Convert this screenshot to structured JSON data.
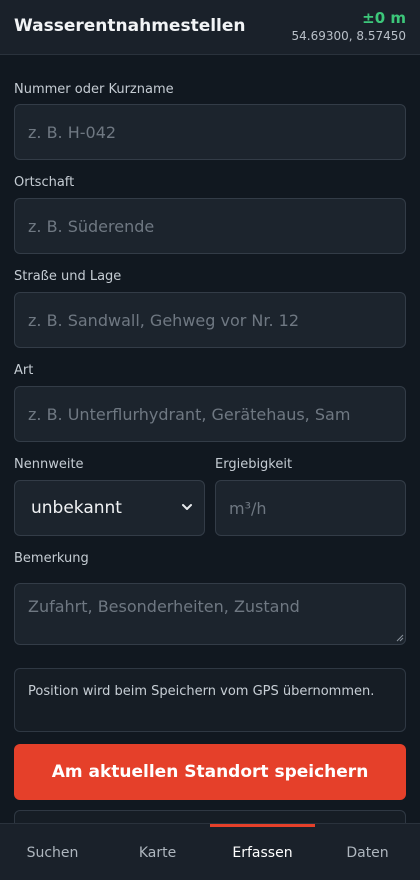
{
  "header": {
    "title": "Wasserentnahmestellen",
    "gps_accuracy": "±0 m",
    "gps_coords": "54.69300, 8.57450",
    "accuracy_color": "#3cc77a"
  },
  "form": {
    "nummer": {
      "label": "Nummer oder Kurzname",
      "placeholder": "z. B. H-042",
      "value": ""
    },
    "ortschaft": {
      "label": "Ortschaft",
      "placeholder": "z. B. Süderende",
      "value": ""
    },
    "strasse": {
      "label": "Straße und Lage",
      "placeholder": "z. B. Sandwall, Gehweg vor Nr. 12",
      "value": ""
    },
    "art": {
      "label": "Art",
      "placeholder": "z. B. Unterflurhydrant, Gerätehaus, Sam",
      "value": ""
    },
    "nennweite": {
      "label": "Nennweite",
      "selected": "unbekannt"
    },
    "ergiebigkeit": {
      "label": "Ergiebigkeit",
      "placeholder": "m³/h",
      "value": ""
    },
    "bemerkung": {
      "label": "Bemerkung",
      "placeholder": "Zufahrt, Besonderheiten, Zustand",
      "value": ""
    }
  },
  "info": {
    "text": "Position wird beim Speichern vom GPS übernommen."
  },
  "save_button": {
    "label": "Am aktuellen Standort speichern",
    "color": "#e5402a"
  },
  "nav": {
    "tabs": [
      {
        "label": "Suchen",
        "active": false
      },
      {
        "label": "Karte",
        "active": false
      },
      {
        "label": "Erfassen",
        "active": true
      },
      {
        "label": "Daten",
        "active": false
      }
    ]
  }
}
